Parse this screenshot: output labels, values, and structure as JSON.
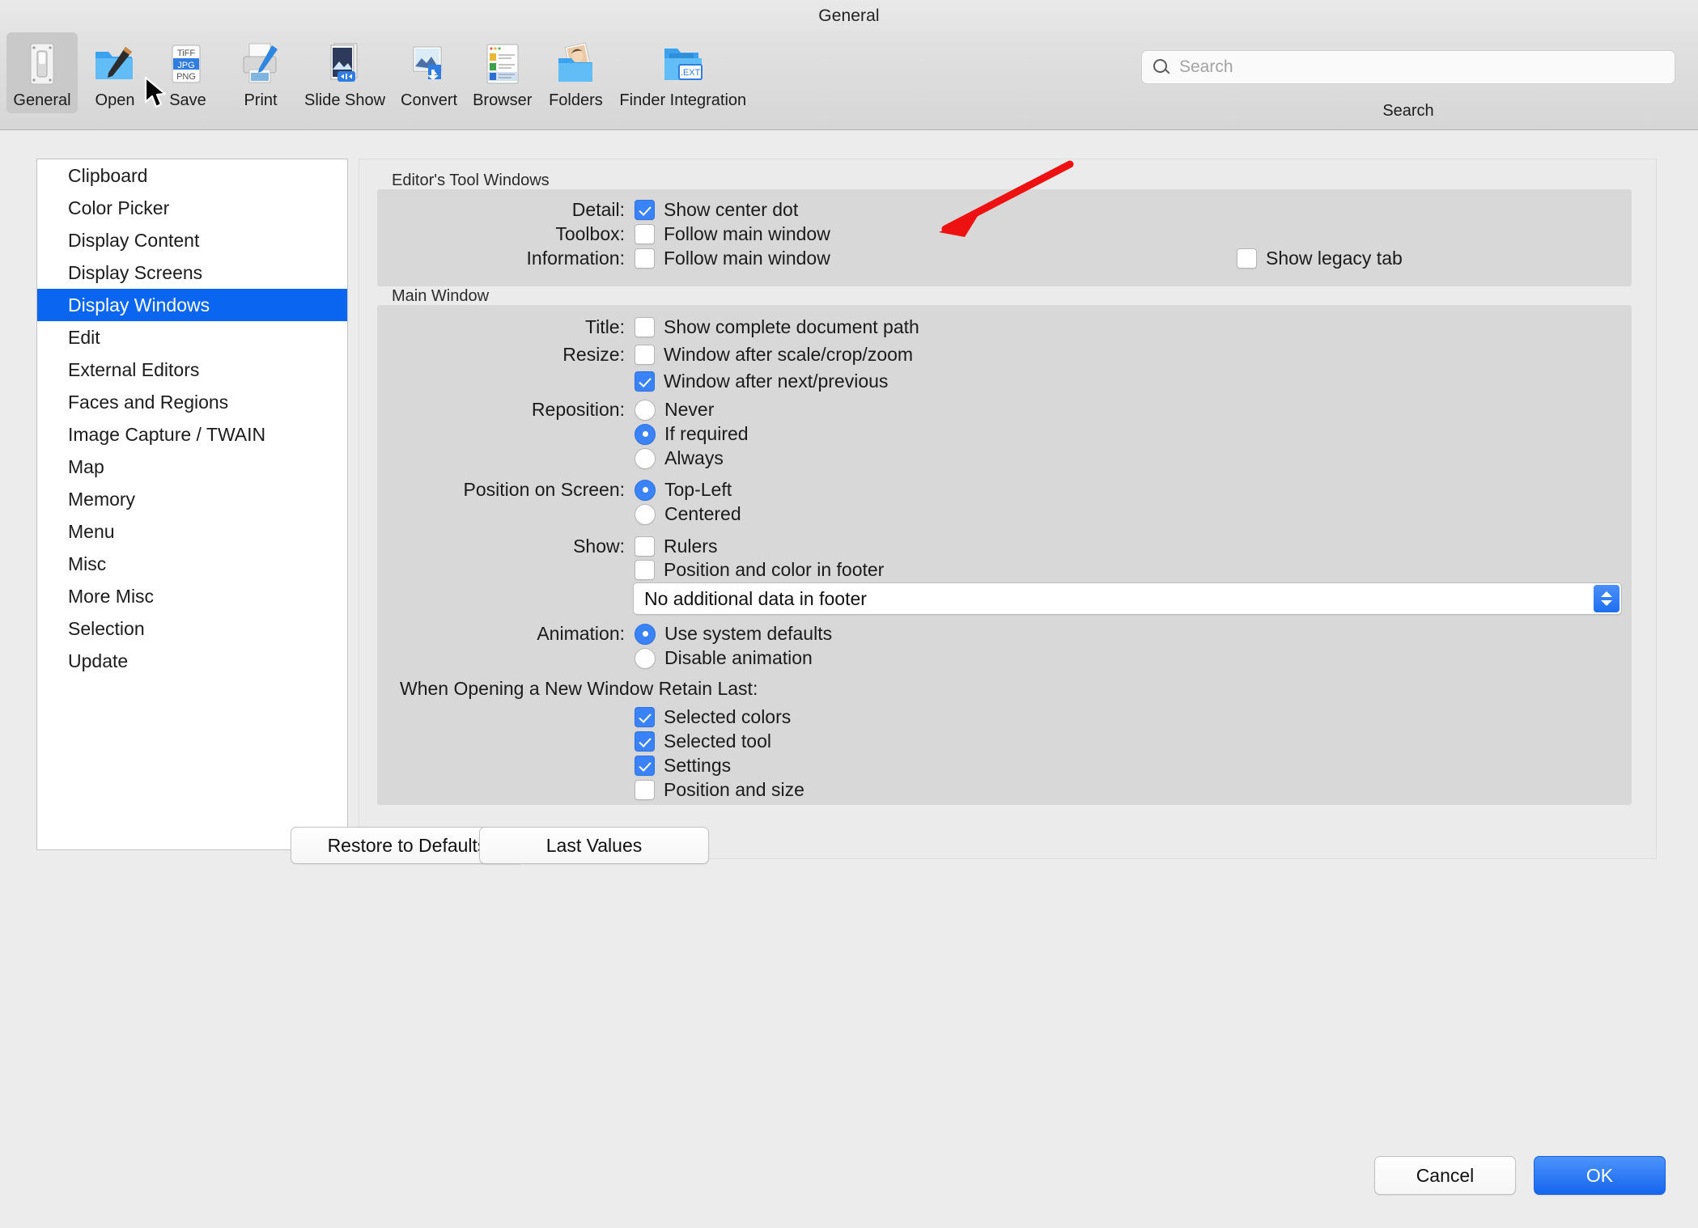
{
  "window": {
    "title": "General"
  },
  "toolbar": {
    "items": [
      {
        "label": "General",
        "icon": "switch-panel-icon",
        "selected": true
      },
      {
        "label": "Open",
        "icon": "folder-brush-icon",
        "selected": false
      },
      {
        "label": "Save",
        "icon": "file-formats-icon",
        "selected": false
      },
      {
        "label": "Print",
        "icon": "printer-icon",
        "selected": false
      },
      {
        "label": "Slide Show",
        "icon": "slideshow-icon",
        "selected": false
      },
      {
        "label": "Convert",
        "icon": "convert-icon",
        "selected": false
      },
      {
        "label": "Browser",
        "icon": "browser-list-icon",
        "selected": false
      },
      {
        "label": "Folders",
        "icon": "folders-photos-icon",
        "selected": false
      },
      {
        "label": "Finder Integration",
        "icon": "finder-ext-icon",
        "selected": false
      }
    ],
    "search": {
      "placeholder": "Search",
      "value": "",
      "caption": "Search",
      "icon": "search-icon"
    }
  },
  "sidebar": {
    "items": [
      {
        "label": "Clipboard",
        "selected": false
      },
      {
        "label": "Color Picker",
        "selected": false
      },
      {
        "label": "Display Content",
        "selected": false
      },
      {
        "label": "Display Screens",
        "selected": false
      },
      {
        "label": "Display Windows",
        "selected": true
      },
      {
        "label": "Edit",
        "selected": false
      },
      {
        "label": "External Editors",
        "selected": false
      },
      {
        "label": "Faces and Regions",
        "selected": false
      },
      {
        "label": "Image Capture / TWAIN",
        "selected": false
      },
      {
        "label": "Map",
        "selected": false
      },
      {
        "label": "Memory",
        "selected": false
      },
      {
        "label": "Menu",
        "selected": false
      },
      {
        "label": "Misc",
        "selected": false
      },
      {
        "label": "More Misc",
        "selected": false
      },
      {
        "label": "Selection",
        "selected": false
      },
      {
        "label": "Update",
        "selected": false
      }
    ]
  },
  "panel": {
    "editor_tool_windows": {
      "title": "Editor's Tool Windows",
      "rows": [
        {
          "label": "Detail:",
          "option": "Show center dot",
          "checked": true
        },
        {
          "label": "Toolbox:",
          "option": "Follow main window",
          "checked": false
        },
        {
          "label": "Information:",
          "option": "Follow main window",
          "checked": false
        }
      ],
      "legacy_tab": {
        "option": "Show legacy tab",
        "checked": false
      }
    },
    "main_window": {
      "title": "Main Window",
      "title_row": {
        "label": "Title:",
        "option": "Show complete document path",
        "checked": false
      },
      "resize_row": {
        "label": "Resize:",
        "option": "Window after scale/crop/zoom",
        "checked": false
      },
      "resize_row2": {
        "option": "Window after next/previous",
        "checked": true
      },
      "reposition": {
        "label": "Reposition:",
        "options": [
          {
            "label": "Never",
            "selected": false
          },
          {
            "label": "If required",
            "selected": true
          },
          {
            "label": "Always",
            "selected": false
          }
        ]
      },
      "position_on_screen": {
        "label": "Position on Screen:",
        "options": [
          {
            "label": "Top-Left",
            "selected": true
          },
          {
            "label": "Centered",
            "selected": false
          }
        ]
      },
      "show": {
        "label": "Show:",
        "checkboxes": [
          {
            "option": "Rulers",
            "checked": false
          },
          {
            "option": "Position and color in footer",
            "checked": false
          }
        ],
        "footer_select": {
          "value": "No additional data in footer",
          "icon": "updown-chevrons-icon"
        }
      },
      "animation": {
        "label": "Animation:",
        "options": [
          {
            "label": "Use system defaults",
            "selected": true
          },
          {
            "label": "Disable animation",
            "selected": false
          }
        ]
      },
      "retain": {
        "heading": "When Opening a New Window Retain Last:",
        "checkboxes": [
          {
            "option": "Selected colors",
            "checked": true
          },
          {
            "option": "Selected tool",
            "checked": true
          },
          {
            "option": "Settings",
            "checked": true
          },
          {
            "option": "Position and size",
            "checked": false
          }
        ]
      }
    },
    "buttons": {
      "restore_defaults": "Restore to Defaults",
      "last_values": "Last Values"
    }
  },
  "footer": {
    "cancel": "Cancel",
    "ok": "OK"
  },
  "annotation": {
    "arrow_color": "#ee1111",
    "points_to": "Show legacy tab"
  },
  "colors": {
    "accent": "#0a66f0",
    "control_blue": "#3a82f7",
    "selection_blue": "#0a66f0",
    "window_bg": "#ececec",
    "panel_bg": "#ebebeb",
    "group_bg": "#d8d8d8"
  }
}
